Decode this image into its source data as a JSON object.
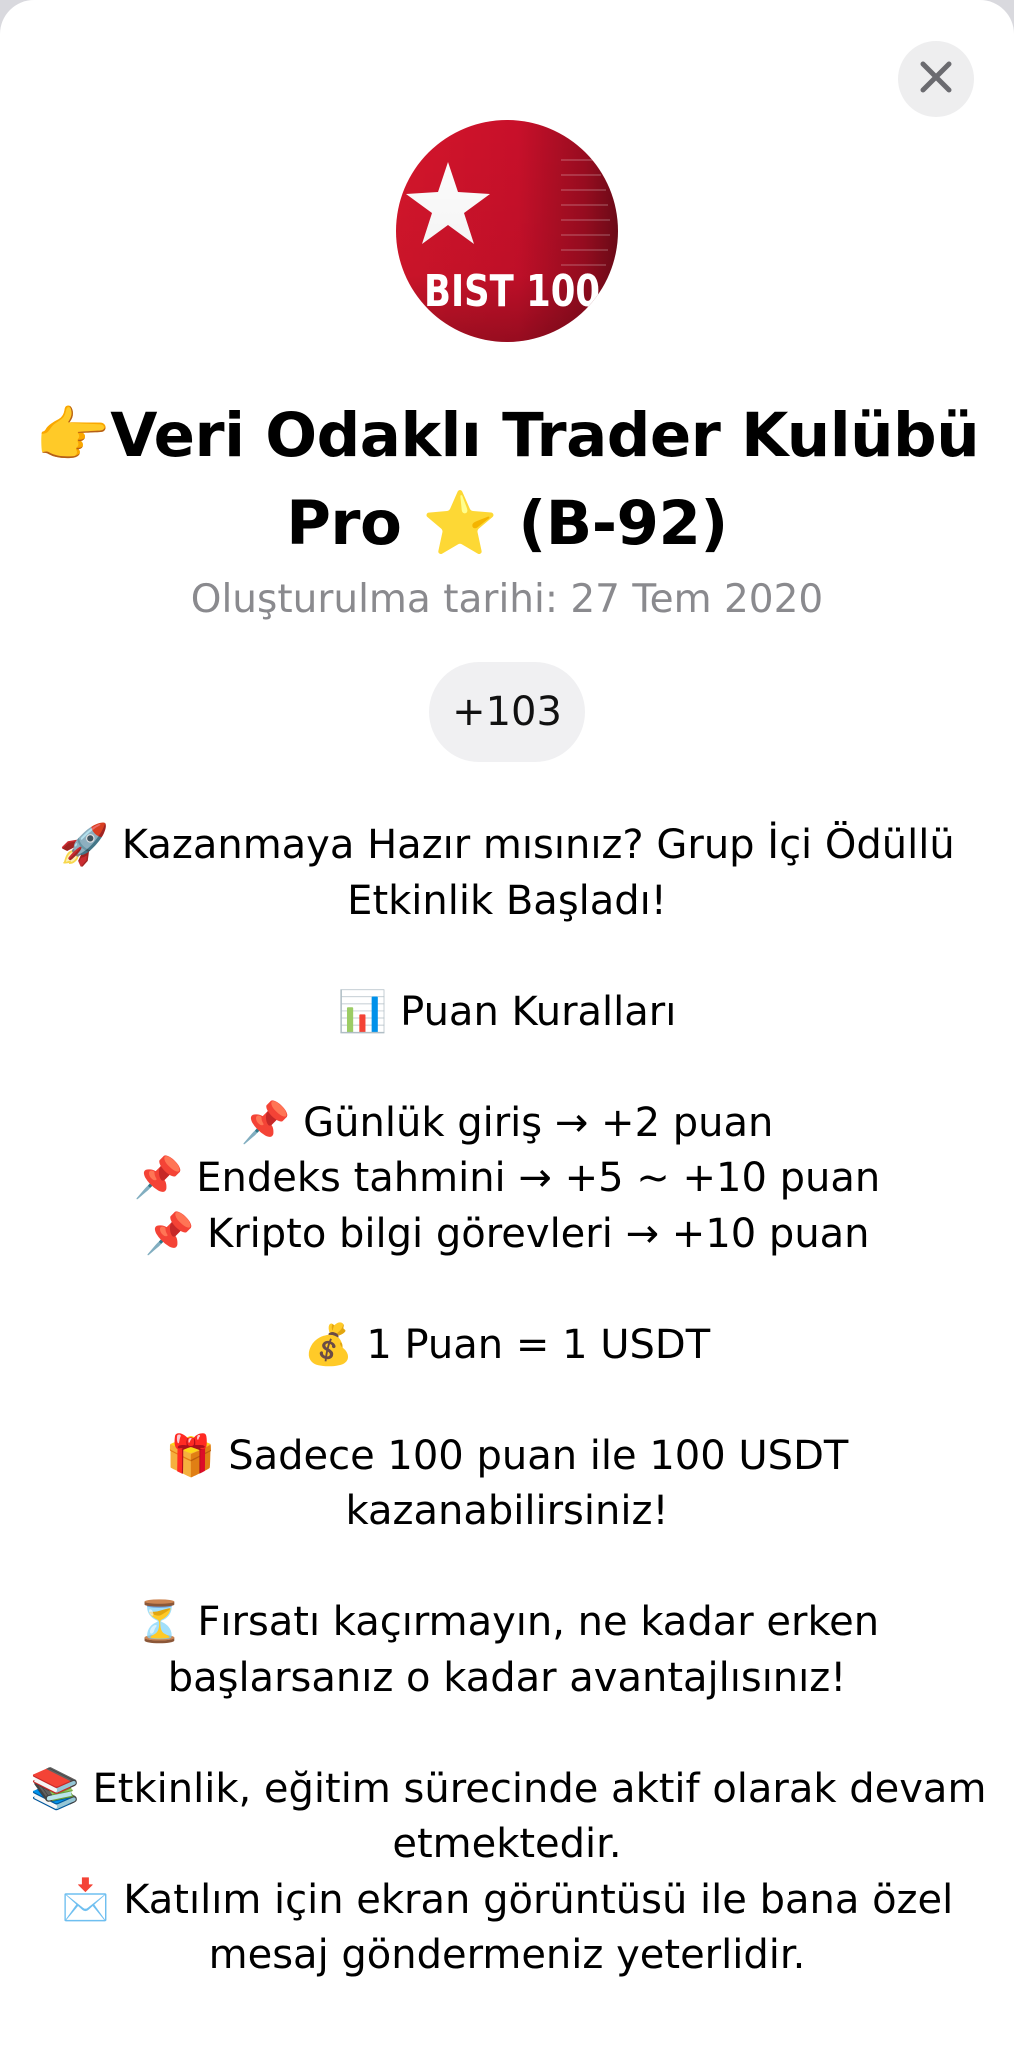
{
  "group": {
    "title_line1": "👉Veri Odaklı Trader Kulübü",
    "title_line2": "Pro ⭐  (B-92)",
    "avatar_text": "BIST 100",
    "created": "Oluşturulma tarihi: 27 Tem 2020",
    "members": "+103"
  },
  "colors": {
    "avatar_red": "#d0142a",
    "pill_bg": "#f0f0f2",
    "subtitle_gray": "#8a8a8e"
  },
  "close_icon": "close-icon",
  "description_lines": [
    "🚀 Kazanmaya Hazır mısınız? Grup İçi Ödüllü",
    "Etkinlik Başladı!",
    "",
    "📊 Puan Kuralları",
    "",
    "📌 Günlük giriş → +2 puan",
    "📌 Endeks tahmini → +5 ~ +10 puan",
    "📌 Kripto bilgi görevleri → +10 puan",
    "",
    "💰 1 Puan = 1 USDT",
    "",
    "🎁 Sadece 100 puan ile 100 USDT",
    "kazanabilirsiniz!",
    "",
    "⏳ Fırsatı kaçırmayın, ne kadar erken",
    "başlarsanız o kadar avantajlısınız!",
    "",
    "📚 Etkinlik, eğitim sürecinde aktif olarak devam",
    "etmektedir.",
    "📩 Katılım için ekran görüntüsü ile bana özel",
    "mesaj göndermeniz yeterlidir."
  ]
}
